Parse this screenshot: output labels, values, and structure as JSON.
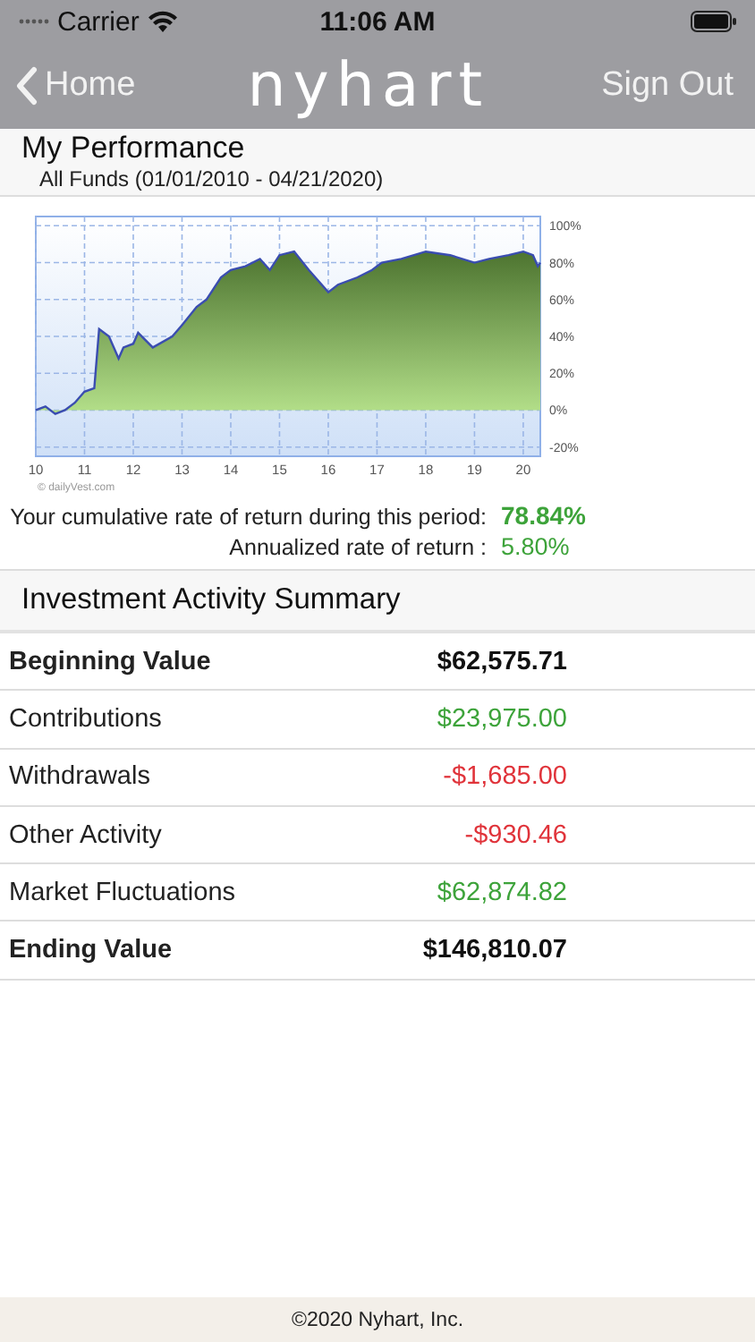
{
  "status_bar": {
    "carrier": "Carrier",
    "time": "11:06 AM"
  },
  "nav": {
    "back": "Home",
    "logo": "nyhart",
    "action": "Sign Out"
  },
  "performance": {
    "title": "My Performance",
    "subtitle": "All Funds (01/01/2010 - 04/21/2020)",
    "chart_data": {
      "type": "area",
      "x": [
        10,
        10.2,
        10.4,
        10.6,
        10.8,
        11,
        11.2,
        11.3,
        11.5,
        11.7,
        11.8,
        12,
        12.1,
        12.4,
        12.8,
        13,
        13.3,
        13.5,
        13.8,
        14,
        14.3,
        14.6,
        14.8,
        15,
        15.3,
        15.6,
        16,
        16.2,
        16.6,
        16.9,
        17.1,
        17.5,
        18,
        18.5,
        19,
        19.3,
        19.7,
        20,
        20.2,
        20.3,
        20.35
      ],
      "values": [
        0,
        2,
        -2,
        0,
        4,
        10,
        12,
        44,
        40,
        28,
        34,
        36,
        42,
        34,
        40,
        46,
        56,
        60,
        72,
        76,
        78,
        82,
        76,
        84,
        86,
        76,
        64,
        68,
        72,
        76,
        80,
        82,
        86,
        84,
        80,
        82,
        84,
        86,
        84,
        78,
        80
      ],
      "xlim": [
        10,
        20.35
      ],
      "ylim": [
        -25,
        105
      ],
      "xticks": [
        {
          "value": 10,
          "label": "10"
        },
        {
          "value": 11,
          "label": "11"
        },
        {
          "value": 12,
          "label": "12"
        },
        {
          "value": 13,
          "label": "13"
        },
        {
          "value": 14,
          "label": "14"
        },
        {
          "value": 15,
          "label": "15"
        },
        {
          "value": 16,
          "label": "16"
        },
        {
          "value": 17,
          "label": "17"
        },
        {
          "value": 18,
          "label": "18"
        },
        {
          "value": 19,
          "label": "19"
        },
        {
          "value": 20,
          "label": "20"
        }
      ],
      "yticks": [
        {
          "value": -20,
          "label": "-20%"
        },
        {
          "value": 0,
          "label": "0%"
        },
        {
          "value": 20,
          "label": "20%"
        },
        {
          "value": 40,
          "label": "40%"
        },
        {
          "value": 60,
          "label": "60%"
        },
        {
          "value": 80,
          "label": "80%"
        },
        {
          "value": 100,
          "label": "100%"
        }
      ],
      "grid": true,
      "annotations": [
        {
          "text": "© dailyVest.com"
        }
      ]
    },
    "returns": [
      {
        "label": "Your cumulative rate of return during this period:",
        "value": "78.84%",
        "emphasis": true
      },
      {
        "label": "Annualized rate of return :",
        "value": "5.80%",
        "emphasis": false
      }
    ]
  },
  "summary": {
    "title": "Investment Activity Summary",
    "rows": [
      {
        "label": "Beginning Value",
        "value": "$62,575.71",
        "kind": "total"
      },
      {
        "label": "Contributions",
        "value": "$23,975.00",
        "kind": "gain"
      },
      {
        "label": "Withdrawals",
        "value": "-$1,685.00",
        "kind": "loss"
      },
      {
        "label": "Other Activity",
        "value": "-$930.46",
        "kind": "loss"
      },
      {
        "label": "Market Fluctuations",
        "value": "$62,874.82",
        "kind": "gain"
      },
      {
        "label": "Ending Value",
        "value": "$146,810.07",
        "kind": "total"
      }
    ]
  },
  "footer": "©2020 Nyhart, Inc."
}
